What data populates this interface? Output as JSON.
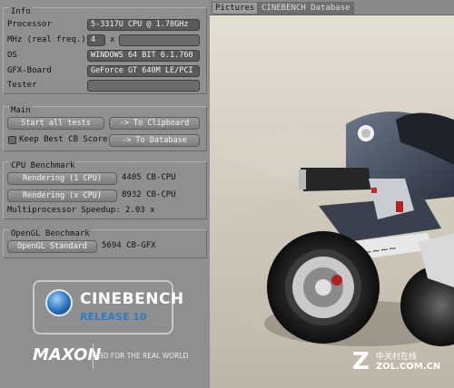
{
  "info": {
    "title": "Info",
    "processor_label": "Processor",
    "processor_value": "5-3317U CPU @ 1.70GHz",
    "mhz_label": "MHz (real freq.)",
    "mhz_value": "4",
    "mhz_sep": "x",
    "os_label": "OS",
    "os_value": "WINDOWS 64 BIT 6.1.760",
    "gfx_label": "GFX-Board",
    "gfx_value": "GeForce GT 640M LE/PCI",
    "tester_label": "Tester",
    "tester_value": ""
  },
  "main": {
    "title": "Main",
    "start_all_label": "Start all tests",
    "clipboard_label": "-> To Clipboard",
    "keep_best_label": "Keep Best CB Score",
    "database_label": "-> To Database"
  },
  "cpu": {
    "title": "CPU Benchmark",
    "single_label": "Rendering (1 CPU)",
    "single_value": "4405 CB-CPU",
    "multi_label": "Rendering (x CPU)",
    "multi_value": "8932 CB-CPU",
    "speedup_text": "Multiprocessor Speedup: 2.03 x"
  },
  "opengl": {
    "title": "OpenGL Benchmark",
    "standard_label": "OpenGL Standard",
    "standard_value": "5694 CB-GFX"
  },
  "logo": {
    "name": "CINEBENCH",
    "release": "RELEASE 10",
    "maxon": "MAXON",
    "tagline": "3D FOR THE REAL WORLD"
  },
  "tabs": [
    {
      "label": "Pictures"
    },
    {
      "label": "CINEBENCH Database"
    }
  ],
  "watermark": {
    "mark": "Z",
    "cn_text": "中关村在线",
    "url": "ZOL.COM.CN"
  }
}
